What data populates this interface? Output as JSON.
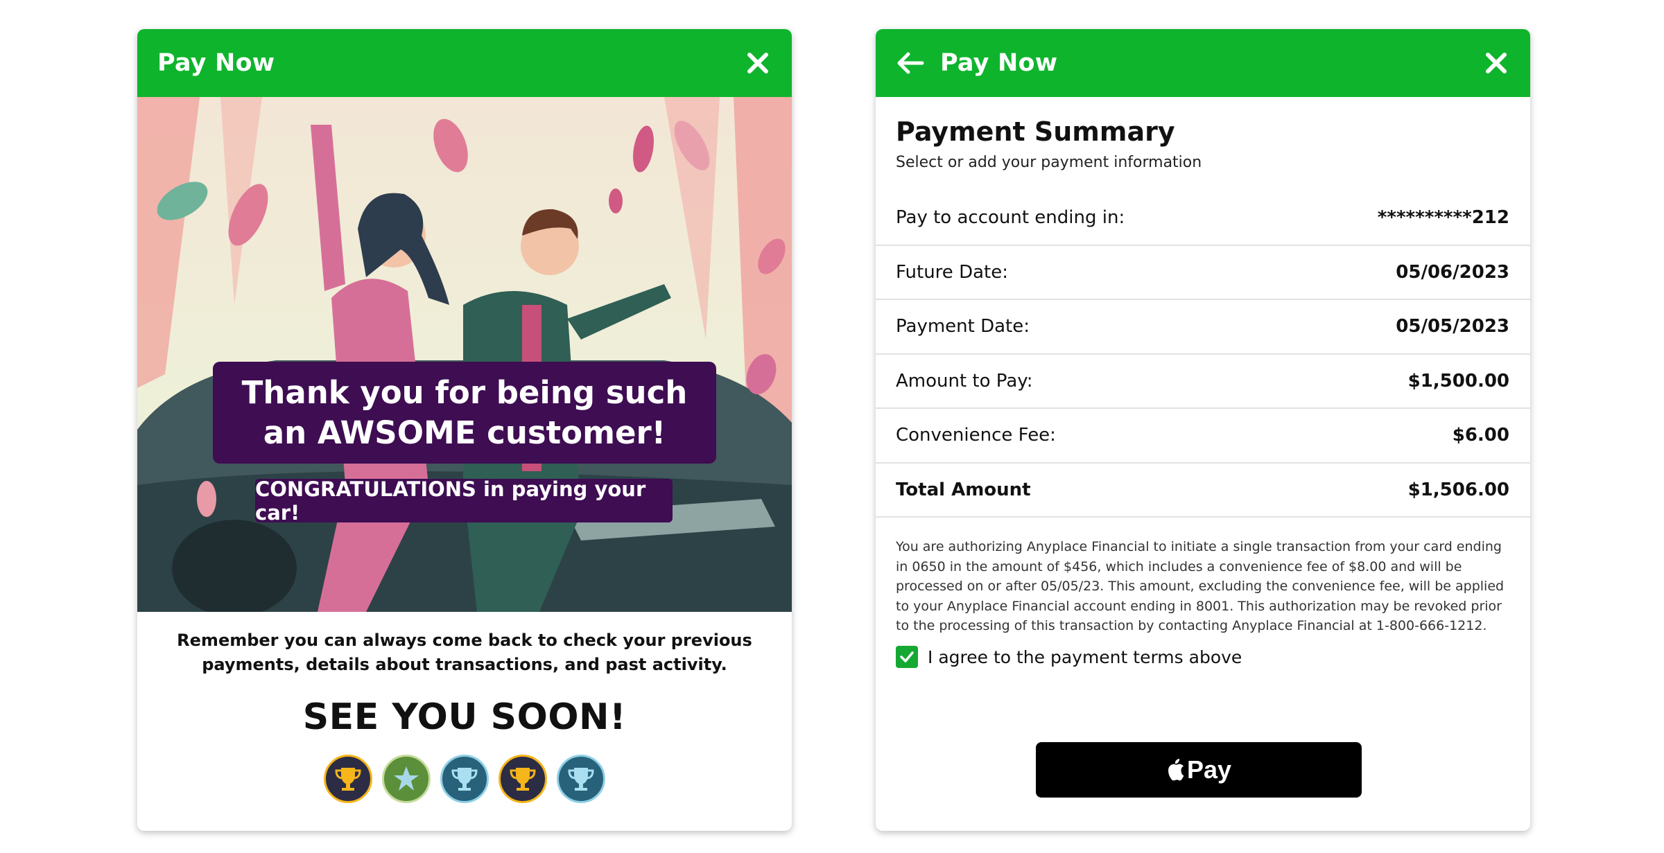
{
  "left_card": {
    "header_title": "Pay Now",
    "thanks_message": "Thank you for being such an AWSOME customer!",
    "congrats_message": "CONGRATULATIONS in paying your car!",
    "reminder_text": "Remember you can always come back to check your previous payments, details about transactions, and past activity.",
    "farewell": "SEE YOU SOON!",
    "badges": [
      "gold-trophy-icon",
      "green-star-badge-icon",
      "blue-trophy-icon",
      "gold-trophy-icon",
      "blue-trophy-icon"
    ]
  },
  "right_card": {
    "header_title": "Pay Now",
    "summary_title": "Payment Summary",
    "summary_subtitle": "Select or add your payment information",
    "rows": [
      {
        "label": "Pay to account ending in:",
        "value": "**********212"
      },
      {
        "label": "Future Date:",
        "value": "05/06/2023"
      },
      {
        "label": "Payment Date:",
        "value": "05/05/2023"
      },
      {
        "label": "Amount to Pay:",
        "value": "$1,500.00"
      },
      {
        "label": "Convenience Fee:",
        "value": "$6.00"
      },
      {
        "label": "Total Amount",
        "value": "$1,506.00"
      }
    ],
    "authorization_text": "You are authorizing  Anyplace Financial to initiate a single transaction from your card ending in 0650 in the amount of $456, which includes a convenience fee of $8.00 and will be processed on or after 05/05/23. This amount, excluding the convenience fee, will be applied to your Anyplace Financial account ending in 8001. This authorization may be revoked prior to the processing of this transaction by contacting Anyplace Financial at 1-800-666-1212.",
    "agree_label": "I agree to the payment terms above",
    "agree_checked": true,
    "pay_button_label": "Pay"
  },
  "colors": {
    "header_green": "#0fb42d",
    "banner_purple": "#3e0d52",
    "checkbox_green": "#15a832"
  }
}
